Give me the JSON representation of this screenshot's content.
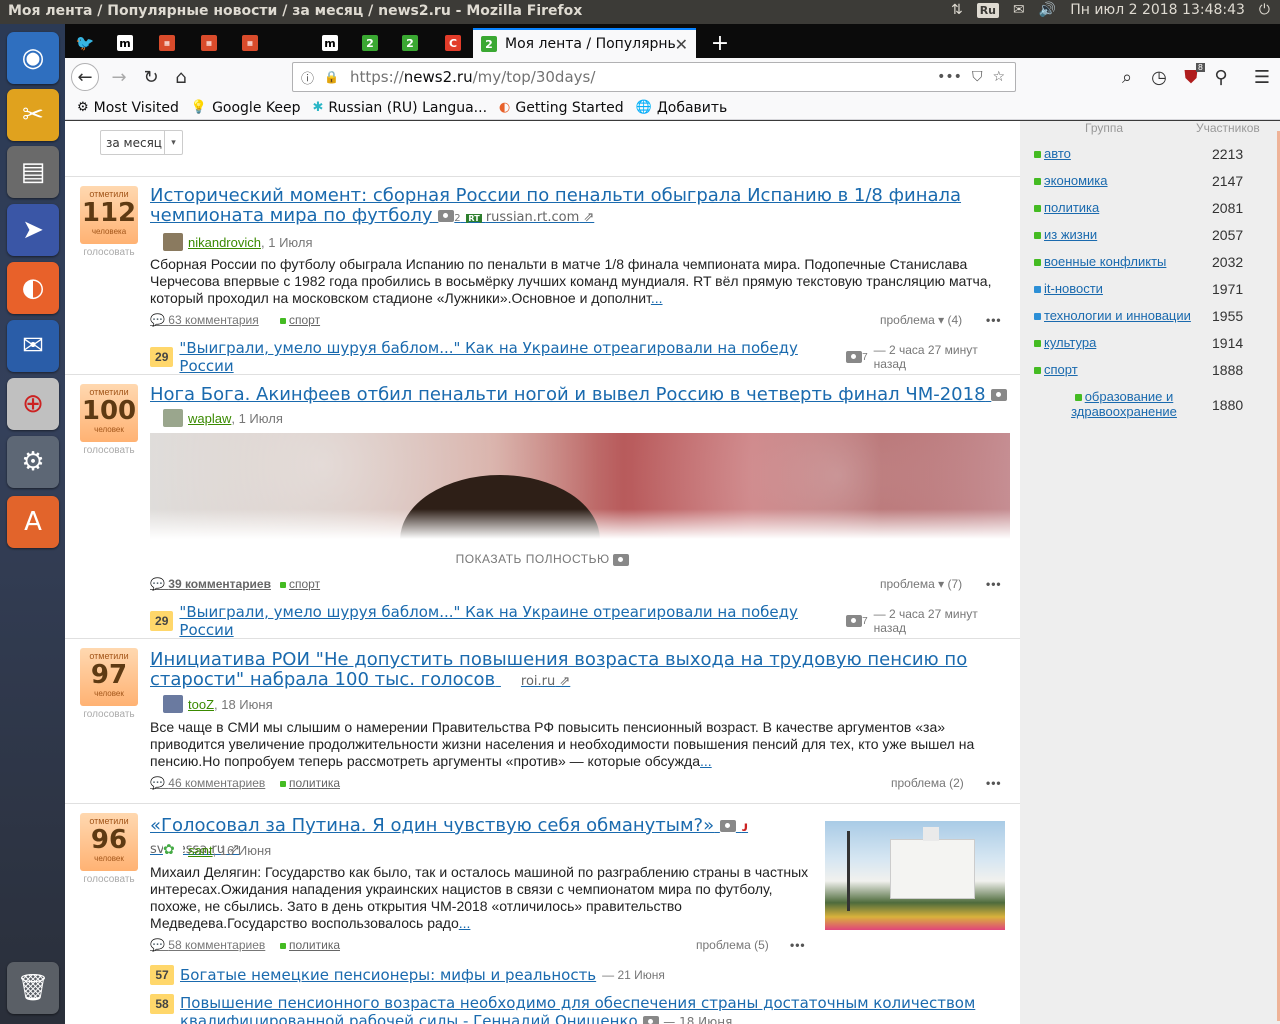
{
  "window": {
    "title": "Моя лента / Популярные новости / за месяц / news2.ru - Mozilla Firefox"
  },
  "panel": {
    "keyboard": "Ru",
    "datetime": "Пн июл  2 2018 13:48:43"
  },
  "launcher": {
    "items": [
      "ubuntu-icon",
      "tools-icon",
      "files-icon",
      "presentation-icon",
      "firefox-icon",
      "thunderbird-icon",
      "target-icon",
      "settings-icon",
      "software-center-icon",
      "trash-icon"
    ]
  },
  "tabs": {
    "pinned": [
      "twitter",
      "m",
      "hype",
      "hype",
      "hype",
      "m",
      "news2",
      "news2",
      "rt"
    ],
    "active": {
      "title": "Моя лента / Популярны"
    },
    "new_tab": "+"
  },
  "navbar": {
    "url_prefix": "https://",
    "url_domain": "news2.ru",
    "url_path": "/my/top/30days/",
    "more": "•••",
    "addon_badge": "8"
  },
  "bookmarks": [
    {
      "icon": "gear-icon",
      "label": "Most Visited"
    },
    {
      "icon": "keep-icon",
      "label": "Google Keep"
    },
    {
      "icon": "translate-icon",
      "label": "Russian (RU) Langua..."
    },
    {
      "icon": "firefox-icon",
      "label": "Getting Started"
    },
    {
      "icon": "globe-icon",
      "label": "Добавить"
    }
  ],
  "filter": {
    "selected": "за месяц",
    "caret": "▾"
  },
  "posts": [
    {
      "votes_label": "отметили",
      "votes": "112",
      "votes_unit": "человека",
      "vote_action": "голосовать",
      "title": "Исторический момент: сборная России по пенальти обыграла Испанию в 1/8 финала чемпионата мира по футболу",
      "photos": "2",
      "source": "russian.rt.com",
      "user": "nikandrovich",
      "date": ", 1 Июля",
      "desc": "Сборная России по футболу обыграла Испанию по пенальти в матче 1/8 финала чемпионата мира. Подопечные Станислава Черчесова впервые с 1982 года пробились в восьмёрку лучших команд мундиаля. RT вёл прямую текстовую трансляцию матча, который проходил на московском стадионе «Лужники».Основное и дополнит",
      "ellipsis": "...",
      "comments": "63 комментария",
      "tag": "спорт",
      "problem": "проблема ▾ (4)",
      "related": [
        {
          "badge": "29",
          "title": "\"Выиграли, умело шуруя баблом...\" Как на Украине отреагировали на победу России",
          "photos": "7",
          "time": "— 2 часа 27 минут назад"
        }
      ]
    },
    {
      "votes_label": "отметили",
      "votes": "100",
      "votes_unit": "человек",
      "vote_action": "голосовать",
      "title": "Нога Бога. Акинфеев отбил пенальти ногой и вывел Россию в четверть финал ЧМ-2018",
      "user": "waplaw",
      "date": ", 1 Июля",
      "show_full": "ПОКАЗАТЬ ПОЛНОСТЬЮ",
      "comments": "39 комментариев",
      "tag": "спорт",
      "problem": "проблема ▾ (7)",
      "related": [
        {
          "badge": "29",
          "title": "\"Выиграли, умело шуруя баблом...\" Как на Украине отреагировали на победу России",
          "photos": "7",
          "time": "— 2 часа 27 минут назад"
        }
      ]
    },
    {
      "votes_label": "отметили",
      "votes": "97",
      "votes_unit": "человек",
      "vote_action": "голосовать",
      "title": "Инициатива РОИ \"Не допустить повышения возраста выхода на трудовую пенсию по старости\" набрала 100 тыс. голосов",
      "source": "roi.ru",
      "user": "tooZ",
      "date": ", 18 Июня",
      "desc": "Все чаще в СМИ мы слышим о намерении Правительства РФ повысить пенсионный возраст. В качестве аргументов «за» приводится увеличение продолжительности жизни населения и необходимости повышения пенсий для тех, кто уже вышел на пенсию.Но попробуем теперь рассмотреть аргументы «против» — которые обсужда",
      "ellipsis": "...",
      "comments": "46 комментариев",
      "tag": "политика",
      "problem": "проблема (2)"
    },
    {
      "votes_label": "отметили",
      "votes": "96",
      "votes_unit": "человек",
      "vote_action": "голосовать",
      "title": "«Голосовал за Путина. Я один чувствую себя обманутым?»",
      "source": "svpressa.ru",
      "user": "sant",
      "date": ", 16 Июня",
      "desc": "Михаил Делягин: Государство как было, так и осталось машиной по разграблению страны в частных интересах.Ожидания нападения украинских нацистов в связи с чемпионатом мира по футболу, похоже, не сбылись. Зато в день открытия ЧМ-2018 «отличилось» правительство Медведева.Государство воспользовалось радо",
      "ellipsis": "...",
      "comments": "58 комментариев",
      "tag": "политика",
      "problem": "проблема (5)",
      "related": [
        {
          "badge": "57",
          "title": "Богатые немецкие пенсионеры: мифы и реальность",
          "time": "— 21 Июня"
        },
        {
          "badge": "58",
          "title": "Повышение пенсионного возраста необходимо для обеспечения страны достаточным количеством",
          "title2": "квалифицированной рабочей силы - Геннадий Онищенко",
          "time": "— 18 Июня"
        }
      ]
    }
  ],
  "sidebar": {
    "col_group": "Группа",
    "col_members": "Участников",
    "groups": [
      {
        "name": "авто",
        "count": "2213",
        "color": "#44bb22"
      },
      {
        "name": "экономика",
        "count": "2147",
        "color": "#44bb22"
      },
      {
        "name": "политика",
        "count": "2081",
        "color": "#44bb22"
      },
      {
        "name": "из жизни",
        "count": "2057",
        "color": "#44bb22"
      },
      {
        "name": "военные конфликты",
        "count": "2032",
        "color": "#44bb22"
      },
      {
        "name": "it-новости",
        "count": "1971",
        "color": "#2c8fd6"
      },
      {
        "name": "технологии и инновации",
        "count": "1955",
        "color": "#2c8fd6"
      },
      {
        "name": "культура",
        "count": "1914",
        "color": "#44bb22"
      },
      {
        "name": "спорт",
        "count": "1888",
        "color": "#44bb22"
      },
      {
        "name": "образование и здравоохранение",
        "count": "1880",
        "color": "#44bb22"
      }
    ]
  }
}
